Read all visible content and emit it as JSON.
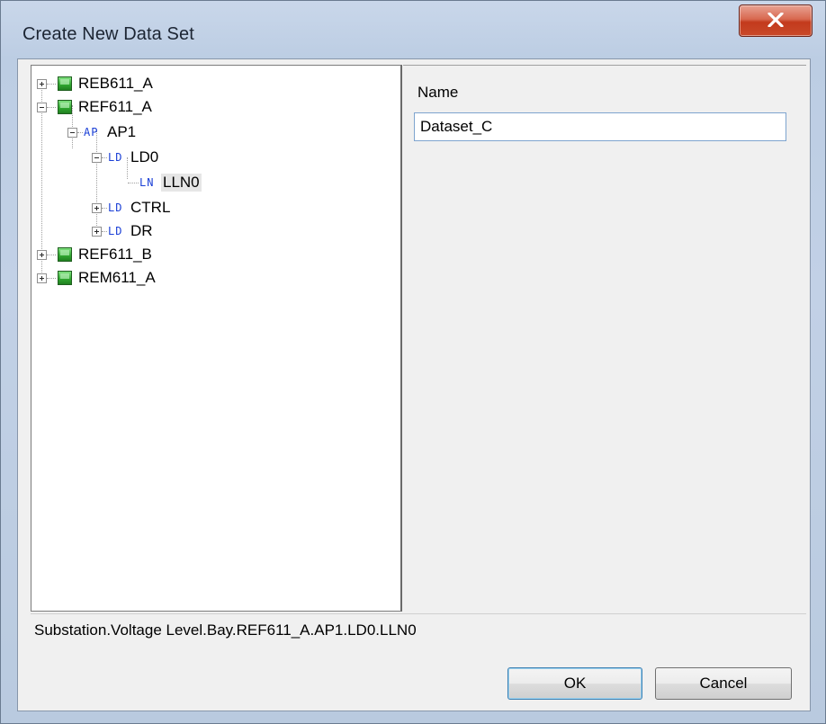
{
  "window": {
    "title": "Create New Data Set",
    "close_icon": "close-x-icon"
  },
  "tree": {
    "nodes": [
      {
        "label": "REB611_A",
        "type_icon": "ied-icon",
        "expander": "plus"
      },
      {
        "label": "REF611_A",
        "type_icon": "ied-icon",
        "expander": "minus"
      },
      {
        "label": "AP1",
        "type_tag": "AP",
        "expander": "minus"
      },
      {
        "label": "LD0",
        "type_tag": "LD",
        "expander": "minus"
      },
      {
        "label": "LLN0",
        "type_tag": "LN",
        "selected": true
      },
      {
        "label": "CTRL",
        "type_tag": "LD",
        "expander": "plus"
      },
      {
        "label": "DR",
        "type_tag": "LD",
        "expander": "plus"
      },
      {
        "label": "REF611_B",
        "type_icon": "ied-icon",
        "expander": "plus"
      },
      {
        "label": "REM611_A",
        "type_icon": "ied-icon",
        "expander": "plus"
      }
    ]
  },
  "form": {
    "name_label": "Name",
    "name_value": "Dataset_C"
  },
  "status": {
    "path": "Substation.Voltage Level.Bay.REF611_A.AP1.LD0.LLN0"
  },
  "buttons": {
    "ok": "OK",
    "cancel": "Cancel"
  },
  "colors": {
    "tag_blue": "#1a3fd6",
    "ied_green": "#2fa52f",
    "close_red": "#c9492a",
    "input_border": "#7ea4cf"
  }
}
